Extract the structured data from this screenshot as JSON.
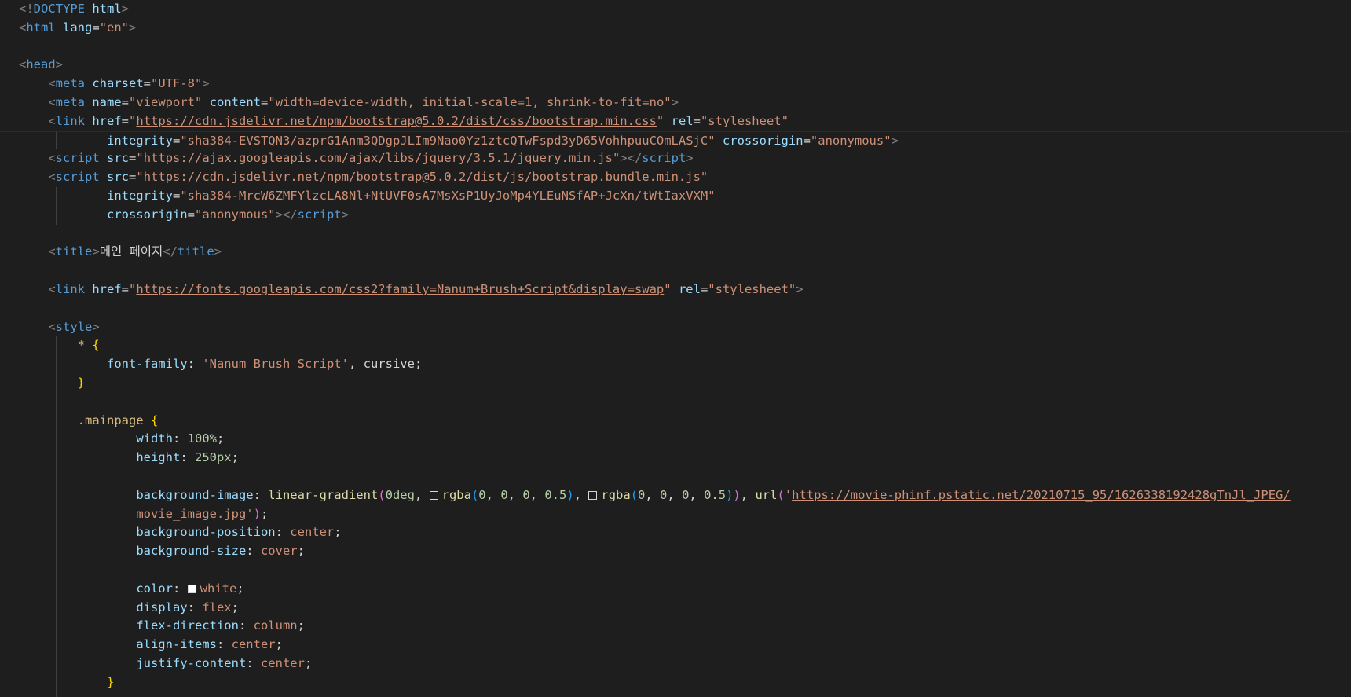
{
  "editor": {
    "lines": [
      {
        "indent": 0,
        "guides": [],
        "tokens": [
          {
            "c": "punct",
            "t": "<!"
          },
          {
            "c": "tag",
            "t": "DOCTYPE"
          },
          {
            "c": "txt",
            "t": " "
          },
          {
            "c": "attr",
            "t": "html"
          },
          {
            "c": "punct",
            "t": ">"
          }
        ]
      },
      {
        "indent": 0,
        "guides": [],
        "tokens": [
          {
            "c": "punct",
            "t": "<"
          },
          {
            "c": "tag",
            "t": "html"
          },
          {
            "c": "txt",
            "t": " "
          },
          {
            "c": "attr",
            "t": "lang"
          },
          {
            "c": "eq",
            "t": "="
          },
          {
            "c": "str",
            "t": "\"en\""
          },
          {
            "c": "punct",
            "t": ">"
          }
        ]
      },
      {
        "indent": 0,
        "guides": [],
        "tokens": []
      },
      {
        "indent": 0,
        "guides": [],
        "tokens": [
          {
            "c": "punct",
            "t": "<"
          },
          {
            "c": "tag",
            "t": "head"
          },
          {
            "c": "punct",
            "t": ">"
          }
        ]
      },
      {
        "indent": 4,
        "guides": [
          0
        ],
        "tokens": [
          {
            "c": "punct",
            "t": "<"
          },
          {
            "c": "tag",
            "t": "meta"
          },
          {
            "c": "txt",
            "t": " "
          },
          {
            "c": "attr",
            "t": "charset"
          },
          {
            "c": "eq",
            "t": "="
          },
          {
            "c": "str",
            "t": "\"UTF-8\""
          },
          {
            "c": "punct",
            "t": ">"
          }
        ]
      },
      {
        "indent": 4,
        "guides": [
          0
        ],
        "tokens": [
          {
            "c": "punct",
            "t": "<"
          },
          {
            "c": "tag",
            "t": "meta"
          },
          {
            "c": "txt",
            "t": " "
          },
          {
            "c": "attr",
            "t": "name"
          },
          {
            "c": "eq",
            "t": "="
          },
          {
            "c": "str",
            "t": "\"viewport\""
          },
          {
            "c": "txt",
            "t": " "
          },
          {
            "c": "attr",
            "t": "content"
          },
          {
            "c": "eq",
            "t": "="
          },
          {
            "c": "str",
            "t": "\"width=device-width, initial-scale=1, shrink-to-fit=no\""
          },
          {
            "c": "punct",
            "t": ">"
          }
        ]
      },
      {
        "indent": 4,
        "guides": [
          0
        ],
        "tokens": [
          {
            "c": "punct",
            "t": "<"
          },
          {
            "c": "tag",
            "t": "link"
          },
          {
            "c": "txt",
            "t": " "
          },
          {
            "c": "attr",
            "t": "href"
          },
          {
            "c": "eq",
            "t": "="
          },
          {
            "c": "str",
            "t": "\""
          },
          {
            "c": "url",
            "t": "https://cdn.jsdelivr.net/npm/bootstrap@5.0.2/dist/css/bootstrap.min.css"
          },
          {
            "c": "str",
            "t": "\""
          },
          {
            "c": "txt",
            "t": " "
          },
          {
            "c": "attr",
            "t": "rel"
          },
          {
            "c": "eq",
            "t": "="
          },
          {
            "c": "str",
            "t": "\"stylesheet\""
          }
        ]
      },
      {
        "indent": 12,
        "guides": [
          0,
          4,
          8
        ],
        "highlight": true,
        "tokens": [
          {
            "c": "attr",
            "t": "integrity"
          },
          {
            "c": "eq",
            "t": "="
          },
          {
            "c": "str",
            "t": "\"sha384-EVSTQN3/azprG1Anm3QDgpJLIm9Nao0Yz1ztcQTwFspd3yD65VohhpuuCOmLASjC\""
          },
          {
            "c": "txt",
            "t": " "
          },
          {
            "c": "attr",
            "t": "crossorigin"
          },
          {
            "c": "eq",
            "t": "="
          },
          {
            "c": "str",
            "t": "\"anonymous\""
          },
          {
            "c": "punct",
            "t": ">"
          }
        ]
      },
      {
        "indent": 4,
        "guides": [
          0
        ],
        "tokens": [
          {
            "c": "punct",
            "t": "<"
          },
          {
            "c": "tag",
            "t": "script"
          },
          {
            "c": "txt",
            "t": " "
          },
          {
            "c": "attr",
            "t": "src"
          },
          {
            "c": "eq",
            "t": "="
          },
          {
            "c": "str",
            "t": "\""
          },
          {
            "c": "url",
            "t": "https://ajax.googleapis.com/ajax/libs/jquery/3.5.1/jquery.min.js"
          },
          {
            "c": "str",
            "t": "\""
          },
          {
            "c": "punct",
            "t": "></"
          },
          {
            "c": "tag",
            "t": "script"
          },
          {
            "c": "punct",
            "t": ">"
          }
        ]
      },
      {
        "indent": 4,
        "guides": [
          0
        ],
        "tokens": [
          {
            "c": "punct",
            "t": "<"
          },
          {
            "c": "tag",
            "t": "script"
          },
          {
            "c": "txt",
            "t": " "
          },
          {
            "c": "attr",
            "t": "src"
          },
          {
            "c": "eq",
            "t": "="
          },
          {
            "c": "str",
            "t": "\""
          },
          {
            "c": "url",
            "t": "https://cdn.jsdelivr.net/npm/bootstrap@5.0.2/dist/js/bootstrap.bundle.min.js"
          },
          {
            "c": "str",
            "t": "\""
          }
        ]
      },
      {
        "indent": 12,
        "guides": [
          0,
          4
        ],
        "tokens": [
          {
            "c": "attr",
            "t": "integrity"
          },
          {
            "c": "eq",
            "t": "="
          },
          {
            "c": "str",
            "t": "\"sha384-MrcW6ZMFYlzcLA8Nl+NtUVF0sA7MsXsP1UyJoMp4YLEuNSfAP+JcXn/tWtIaxVXM\""
          }
        ]
      },
      {
        "indent": 12,
        "guides": [
          0,
          4
        ],
        "tokens": [
          {
            "c": "attr",
            "t": "crossorigin"
          },
          {
            "c": "eq",
            "t": "="
          },
          {
            "c": "str",
            "t": "\"anonymous\""
          },
          {
            "c": "punct",
            "t": "></"
          },
          {
            "c": "tag",
            "t": "script"
          },
          {
            "c": "punct",
            "t": ">"
          }
        ]
      },
      {
        "indent": 0,
        "guides": [
          0
        ],
        "tokens": []
      },
      {
        "indent": 4,
        "guides": [
          0
        ],
        "tokens": [
          {
            "c": "punct",
            "t": "<"
          },
          {
            "c": "tag",
            "t": "title"
          },
          {
            "c": "punct",
            "t": ">"
          },
          {
            "c": "txt",
            "t": "메인 페이지"
          },
          {
            "c": "punct",
            "t": "</"
          },
          {
            "c": "tag",
            "t": "title"
          },
          {
            "c": "punct",
            "t": ">"
          }
        ]
      },
      {
        "indent": 0,
        "guides": [
          0
        ],
        "tokens": []
      },
      {
        "indent": 4,
        "guides": [
          0
        ],
        "tokens": [
          {
            "c": "punct",
            "t": "<"
          },
          {
            "c": "tag",
            "t": "link"
          },
          {
            "c": "txt",
            "t": " "
          },
          {
            "c": "attr",
            "t": "href"
          },
          {
            "c": "eq",
            "t": "="
          },
          {
            "c": "str",
            "t": "\""
          },
          {
            "c": "url",
            "t": "https://fonts.googleapis.com/css2?family=Nanum+Brush+Script&display=swap"
          },
          {
            "c": "str",
            "t": "\""
          },
          {
            "c": "txt",
            "t": " "
          },
          {
            "c": "attr",
            "t": "rel"
          },
          {
            "c": "eq",
            "t": "="
          },
          {
            "c": "str",
            "t": "\"stylesheet\""
          },
          {
            "c": "punct",
            "t": ">"
          }
        ]
      },
      {
        "indent": 0,
        "guides": [
          0
        ],
        "tokens": []
      },
      {
        "indent": 4,
        "guides": [
          0
        ],
        "tokens": [
          {
            "c": "punct",
            "t": "<"
          },
          {
            "c": "tag",
            "t": "style"
          },
          {
            "c": "punct",
            "t": ">"
          }
        ]
      },
      {
        "indent": 8,
        "guides": [
          0,
          4
        ],
        "tokens": [
          {
            "c": "sel",
            "t": "* "
          },
          {
            "c": "brace",
            "t": "{"
          }
        ]
      },
      {
        "indent": 12,
        "guides": [
          0,
          4,
          8
        ],
        "tokens": [
          {
            "c": "prop",
            "t": "font-family"
          },
          {
            "c": "txt",
            "t": ": "
          },
          {
            "c": "str",
            "t": "'Nanum Brush Script'"
          },
          {
            "c": "txt",
            "t": ", cursive;"
          }
        ]
      },
      {
        "indent": 8,
        "guides": [
          0,
          4
        ],
        "tokens": [
          {
            "c": "brace",
            "t": "}"
          }
        ]
      },
      {
        "indent": 0,
        "guides": [
          0,
          4
        ],
        "tokens": []
      },
      {
        "indent": 8,
        "guides": [
          0,
          4
        ],
        "tokens": [
          {
            "c": "sel",
            "t": ".mainpage "
          },
          {
            "c": "brace",
            "t": "{"
          }
        ]
      },
      {
        "indent": 16,
        "guides": [
          0,
          4,
          8,
          12
        ],
        "tokens": [
          {
            "c": "prop",
            "t": "width"
          },
          {
            "c": "txt",
            "t": ": "
          },
          {
            "c": "num",
            "t": "100%"
          },
          {
            "c": "txt",
            "t": ";"
          }
        ]
      },
      {
        "indent": 16,
        "guides": [
          0,
          4,
          8,
          12
        ],
        "tokens": [
          {
            "c": "prop",
            "t": "height"
          },
          {
            "c": "txt",
            "t": ": "
          },
          {
            "c": "num",
            "t": "250px"
          },
          {
            "c": "txt",
            "t": ";"
          }
        ]
      },
      {
        "indent": 0,
        "guides": [
          0,
          4,
          8,
          12
        ],
        "tokens": []
      },
      {
        "indent": 16,
        "guides": [
          0,
          4,
          8,
          12
        ],
        "tokens": [
          {
            "c": "prop",
            "t": "background-image"
          },
          {
            "c": "txt",
            "t": ": "
          },
          {
            "c": "func",
            "t": "linear-gradient"
          },
          {
            "c": "paren2",
            "t": "("
          },
          {
            "c": "num",
            "t": "0deg"
          },
          {
            "c": "txt",
            "t": ", "
          },
          {
            "c": "swatch",
            "t": "#000000",
            "col": "transparent"
          },
          {
            "c": "func",
            "t": "rgba"
          },
          {
            "c": "paren3",
            "t": "("
          },
          {
            "c": "num",
            "t": "0"
          },
          {
            "c": "txt",
            "t": ", "
          },
          {
            "c": "num",
            "t": "0"
          },
          {
            "c": "txt",
            "t": ", "
          },
          {
            "c": "num",
            "t": "0"
          },
          {
            "c": "txt",
            "t": ", "
          },
          {
            "c": "num",
            "t": "0.5"
          },
          {
            "c": "paren3",
            "t": ")"
          },
          {
            "c": "txt",
            "t": ", "
          },
          {
            "c": "swatch",
            "t": "#000000",
            "col": "transparent"
          },
          {
            "c": "func",
            "t": "rgba"
          },
          {
            "c": "paren3",
            "t": "("
          },
          {
            "c": "num",
            "t": "0"
          },
          {
            "c": "txt",
            "t": ", "
          },
          {
            "c": "num",
            "t": "0"
          },
          {
            "c": "txt",
            "t": ", "
          },
          {
            "c": "num",
            "t": "0"
          },
          {
            "c": "txt",
            "t": ", "
          },
          {
            "c": "num",
            "t": "0.5"
          },
          {
            "c": "paren3",
            "t": ")"
          },
          {
            "c": "paren2",
            "t": ")"
          },
          {
            "c": "txt",
            "t": ", "
          },
          {
            "c": "func",
            "t": "url"
          },
          {
            "c": "paren2",
            "t": "("
          },
          {
            "c": "str",
            "t": "'"
          },
          {
            "c": "url",
            "t": "https://movie-phinf.pstatic.net/20210715_95/1626338192428gTnJl_JPEG/"
          }
        ]
      },
      {
        "indent": 16,
        "guides": [
          0,
          4,
          8,
          12
        ],
        "tokens": [
          {
            "c": "url",
            "t": "movie_image.jpg"
          },
          {
            "c": "str",
            "t": "'"
          },
          {
            "c": "paren2",
            "t": ")"
          },
          {
            "c": "txt",
            "t": ";"
          }
        ]
      },
      {
        "indent": 16,
        "guides": [
          0,
          4,
          8,
          12
        ],
        "tokens": [
          {
            "c": "prop",
            "t": "background-position"
          },
          {
            "c": "txt",
            "t": ": "
          },
          {
            "c": "str",
            "t": "center"
          },
          {
            "c": "txt",
            "t": ";"
          }
        ]
      },
      {
        "indent": 16,
        "guides": [
          0,
          4,
          8,
          12
        ],
        "tokens": [
          {
            "c": "prop",
            "t": "background-size"
          },
          {
            "c": "txt",
            "t": ": "
          },
          {
            "c": "str",
            "t": "cover"
          },
          {
            "c": "txt",
            "t": ";"
          }
        ]
      },
      {
        "indent": 0,
        "guides": [
          0,
          4,
          8,
          12
        ],
        "tokens": []
      },
      {
        "indent": 16,
        "guides": [
          0,
          4,
          8,
          12
        ],
        "tokens": [
          {
            "c": "prop",
            "t": "color"
          },
          {
            "c": "txt",
            "t": ": "
          },
          {
            "c": "swatch",
            "t": "#ffffff",
            "col": "#ffffff"
          },
          {
            "c": "str",
            "t": "white"
          },
          {
            "c": "txt",
            "t": ";"
          }
        ]
      },
      {
        "indent": 16,
        "guides": [
          0,
          4,
          8,
          12
        ],
        "tokens": [
          {
            "c": "prop",
            "t": "display"
          },
          {
            "c": "txt",
            "t": ": "
          },
          {
            "c": "str",
            "t": "flex"
          },
          {
            "c": "txt",
            "t": ";"
          }
        ]
      },
      {
        "indent": 16,
        "guides": [
          0,
          4,
          8,
          12
        ],
        "tokens": [
          {
            "c": "prop",
            "t": "flex-direction"
          },
          {
            "c": "txt",
            "t": ": "
          },
          {
            "c": "str",
            "t": "column"
          },
          {
            "c": "txt",
            "t": ";"
          }
        ]
      },
      {
        "indent": 16,
        "guides": [
          0,
          4,
          8,
          12
        ],
        "tokens": [
          {
            "c": "prop",
            "t": "align-items"
          },
          {
            "c": "txt",
            "t": ": "
          },
          {
            "c": "str",
            "t": "center"
          },
          {
            "c": "txt",
            "t": ";"
          }
        ]
      },
      {
        "indent": 16,
        "guides": [
          0,
          4,
          8,
          12
        ],
        "tokens": [
          {
            "c": "prop",
            "t": "justify-content"
          },
          {
            "c": "txt",
            "t": ": "
          },
          {
            "c": "str",
            "t": "center"
          },
          {
            "c": "txt",
            "t": ";"
          }
        ]
      },
      {
        "indent": 12,
        "guides": [
          0,
          4,
          8
        ],
        "tokens": [
          {
            "c": "brace",
            "t": "}"
          }
        ]
      },
      {
        "indent": 0,
        "guides": [
          0,
          4
        ],
        "tokens": []
      }
    ]
  }
}
